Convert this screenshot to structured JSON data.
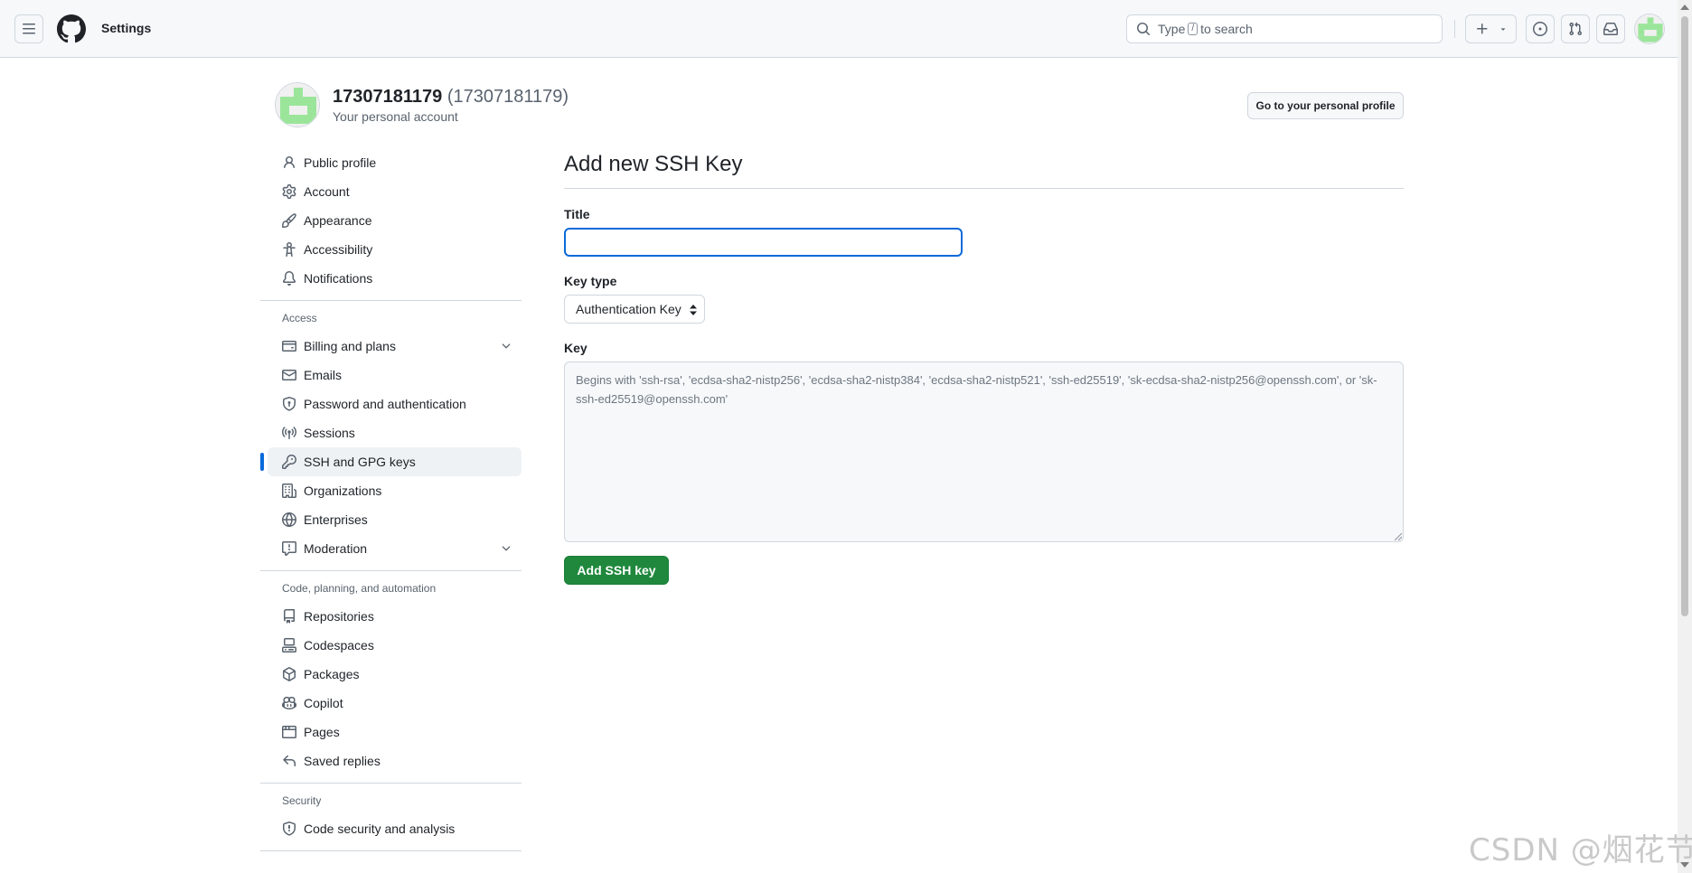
{
  "header": {
    "title": "Settings",
    "search": {
      "prefix": "Type",
      "key": "/",
      "suffix": "to search"
    }
  },
  "account": {
    "name": "17307181179",
    "login": "(17307181179)",
    "subtitle": "Your personal account",
    "profile_button": "Go to your personal profile"
  },
  "sidebar": {
    "top_items": [
      {
        "label": "Public profile",
        "icon": "person-icon"
      },
      {
        "label": "Account",
        "icon": "gear-icon"
      },
      {
        "label": "Appearance",
        "icon": "paintbrush-icon"
      },
      {
        "label": "Accessibility",
        "icon": "accessibility-icon"
      },
      {
        "label": "Notifications",
        "icon": "bell-icon"
      }
    ],
    "access_heading": "Access",
    "access_items": [
      {
        "label": "Billing and plans",
        "icon": "credit-card-icon",
        "expandable": true
      },
      {
        "label": "Emails",
        "icon": "mail-icon"
      },
      {
        "label": "Password and authentication",
        "icon": "shield-lock-icon"
      },
      {
        "label": "Sessions",
        "icon": "broadcast-icon"
      },
      {
        "label": "SSH and GPG keys",
        "icon": "key-icon",
        "active": true
      },
      {
        "label": "Organizations",
        "icon": "organization-icon"
      },
      {
        "label": "Enterprises",
        "icon": "globe-icon"
      },
      {
        "label": "Moderation",
        "icon": "report-icon",
        "expandable": true
      }
    ],
    "code_heading": "Code, planning, and automation",
    "code_items": [
      {
        "label": "Repositories",
        "icon": "repo-icon"
      },
      {
        "label": "Codespaces",
        "icon": "codespaces-icon"
      },
      {
        "label": "Packages",
        "icon": "package-icon"
      },
      {
        "label": "Copilot",
        "icon": "copilot-icon"
      },
      {
        "label": "Pages",
        "icon": "browser-icon"
      },
      {
        "label": "Saved replies",
        "icon": "reply-icon"
      }
    ],
    "security_heading": "Security",
    "security_items": [
      {
        "label": "Code security and analysis",
        "icon": "shield-check-icon"
      }
    ]
  },
  "main": {
    "title": "Add new SSH Key",
    "title_label": "Title",
    "title_value": "",
    "keytype_label": "Key type",
    "keytype_value": "Authentication Key",
    "key_label": "Key",
    "key_placeholder": "Begins with 'ssh-rsa', 'ecdsa-sha2-nistp256', 'ecdsa-sha2-nistp384', 'ecdsa-sha2-nistp521', 'ssh-ed25519', 'sk-ecdsa-sha2-nistp256@openssh.com', or 'sk-ssh-ed25519@openssh.com'",
    "submit_label": "Add SSH key"
  },
  "watermark": "CSDN @烟花节",
  "colors": {
    "accent": "#0969da",
    "primary_button": "#1f883d",
    "avatar_green": "#9be59b",
    "border": "#d0d7de"
  }
}
